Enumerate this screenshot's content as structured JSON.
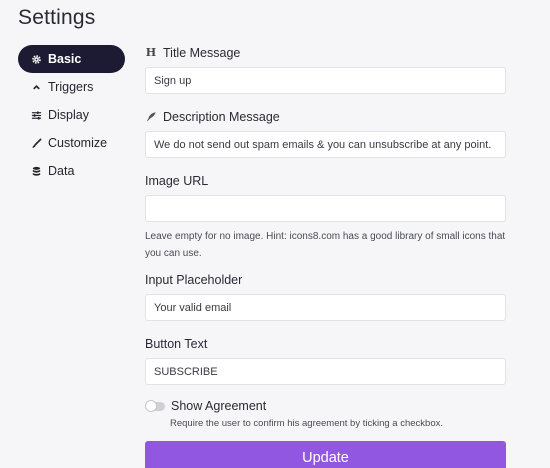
{
  "header": {
    "title": "Settings"
  },
  "sidebar": {
    "items": [
      {
        "label": "Basic",
        "icon": "gear-icon",
        "active": true
      },
      {
        "label": "Triggers",
        "icon": "chevron-up-icon",
        "active": false
      },
      {
        "label": "Display",
        "icon": "sliders-icon",
        "active": false
      },
      {
        "label": "Customize",
        "icon": "brush-icon",
        "active": false
      },
      {
        "label": "Data",
        "icon": "database-icon",
        "active": false
      }
    ]
  },
  "form": {
    "title_message": {
      "label": "Title Message",
      "icon": "heading-icon",
      "icon_glyph": "H",
      "value": "Sign up"
    },
    "description_message": {
      "label": "Description Message",
      "icon": "feather-icon",
      "value": "We do not send out spam emails & you can unsubscribe at any point."
    },
    "image_url": {
      "label": "Image URL",
      "value": "",
      "hint": "Leave empty for no image. Hint: icons8.com has a good library of small icons that you can use."
    },
    "input_placeholder": {
      "label": "Input Placeholder",
      "value": "Your valid email"
    },
    "button_text": {
      "label": "Button Text",
      "value": "SUBSCRIBE"
    },
    "show_agreement": {
      "label": "Show Agreement",
      "enabled": false,
      "hint": "Require the user to confirm his agreement by ticking a checkbox."
    },
    "update_label": "Update"
  },
  "colors": {
    "accent": "#9257e0",
    "sidebar_active": "#1d1a33",
    "background": "#f6f6f9"
  }
}
